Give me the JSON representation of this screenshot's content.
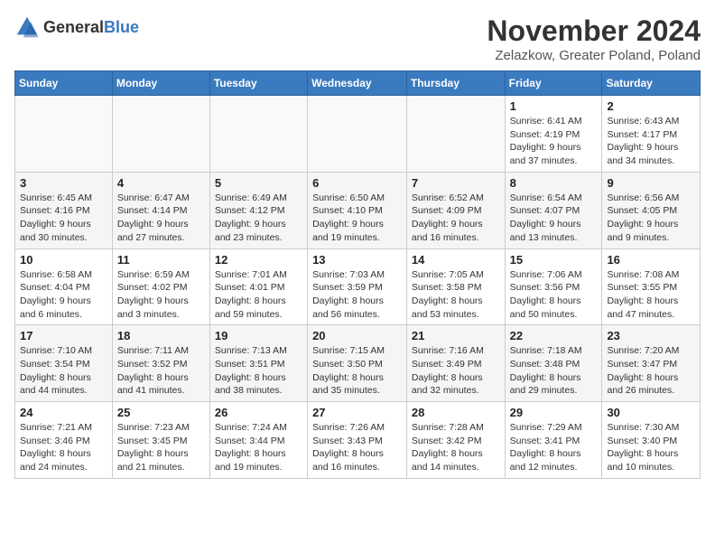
{
  "logo": {
    "text_general": "General",
    "text_blue": "Blue"
  },
  "title": "November 2024",
  "location": "Zelazkow, Greater Poland, Poland",
  "headers": [
    "Sunday",
    "Monday",
    "Tuesday",
    "Wednesday",
    "Thursday",
    "Friday",
    "Saturday"
  ],
  "weeks": [
    [
      {
        "day": "",
        "info": "",
        "empty": true
      },
      {
        "day": "",
        "info": "",
        "empty": true
      },
      {
        "day": "",
        "info": "",
        "empty": true
      },
      {
        "day": "",
        "info": "",
        "empty": true
      },
      {
        "day": "",
        "info": "",
        "empty": true
      },
      {
        "day": "1",
        "info": "Sunrise: 6:41 AM\nSunset: 4:19 PM\nDaylight: 9 hours and 37 minutes."
      },
      {
        "day": "2",
        "info": "Sunrise: 6:43 AM\nSunset: 4:17 PM\nDaylight: 9 hours and 34 minutes."
      }
    ],
    [
      {
        "day": "3",
        "info": "Sunrise: 6:45 AM\nSunset: 4:16 PM\nDaylight: 9 hours and 30 minutes."
      },
      {
        "day": "4",
        "info": "Sunrise: 6:47 AM\nSunset: 4:14 PM\nDaylight: 9 hours and 27 minutes."
      },
      {
        "day": "5",
        "info": "Sunrise: 6:49 AM\nSunset: 4:12 PM\nDaylight: 9 hours and 23 minutes."
      },
      {
        "day": "6",
        "info": "Sunrise: 6:50 AM\nSunset: 4:10 PM\nDaylight: 9 hours and 19 minutes."
      },
      {
        "day": "7",
        "info": "Sunrise: 6:52 AM\nSunset: 4:09 PM\nDaylight: 9 hours and 16 minutes."
      },
      {
        "day": "8",
        "info": "Sunrise: 6:54 AM\nSunset: 4:07 PM\nDaylight: 9 hours and 13 minutes."
      },
      {
        "day": "9",
        "info": "Sunrise: 6:56 AM\nSunset: 4:05 PM\nDaylight: 9 hours and 9 minutes."
      }
    ],
    [
      {
        "day": "10",
        "info": "Sunrise: 6:58 AM\nSunset: 4:04 PM\nDaylight: 9 hours and 6 minutes."
      },
      {
        "day": "11",
        "info": "Sunrise: 6:59 AM\nSunset: 4:02 PM\nDaylight: 9 hours and 3 minutes."
      },
      {
        "day": "12",
        "info": "Sunrise: 7:01 AM\nSunset: 4:01 PM\nDaylight: 8 hours and 59 minutes."
      },
      {
        "day": "13",
        "info": "Sunrise: 7:03 AM\nSunset: 3:59 PM\nDaylight: 8 hours and 56 minutes."
      },
      {
        "day": "14",
        "info": "Sunrise: 7:05 AM\nSunset: 3:58 PM\nDaylight: 8 hours and 53 minutes."
      },
      {
        "day": "15",
        "info": "Sunrise: 7:06 AM\nSunset: 3:56 PM\nDaylight: 8 hours and 50 minutes."
      },
      {
        "day": "16",
        "info": "Sunrise: 7:08 AM\nSunset: 3:55 PM\nDaylight: 8 hours and 47 minutes."
      }
    ],
    [
      {
        "day": "17",
        "info": "Sunrise: 7:10 AM\nSunset: 3:54 PM\nDaylight: 8 hours and 44 minutes."
      },
      {
        "day": "18",
        "info": "Sunrise: 7:11 AM\nSunset: 3:52 PM\nDaylight: 8 hours and 41 minutes."
      },
      {
        "day": "19",
        "info": "Sunrise: 7:13 AM\nSunset: 3:51 PM\nDaylight: 8 hours and 38 minutes."
      },
      {
        "day": "20",
        "info": "Sunrise: 7:15 AM\nSunset: 3:50 PM\nDaylight: 8 hours and 35 minutes."
      },
      {
        "day": "21",
        "info": "Sunrise: 7:16 AM\nSunset: 3:49 PM\nDaylight: 8 hours and 32 minutes."
      },
      {
        "day": "22",
        "info": "Sunrise: 7:18 AM\nSunset: 3:48 PM\nDaylight: 8 hours and 29 minutes."
      },
      {
        "day": "23",
        "info": "Sunrise: 7:20 AM\nSunset: 3:47 PM\nDaylight: 8 hours and 26 minutes."
      }
    ],
    [
      {
        "day": "24",
        "info": "Sunrise: 7:21 AM\nSunset: 3:46 PM\nDaylight: 8 hours and 24 minutes."
      },
      {
        "day": "25",
        "info": "Sunrise: 7:23 AM\nSunset: 3:45 PM\nDaylight: 8 hours and 21 minutes."
      },
      {
        "day": "26",
        "info": "Sunrise: 7:24 AM\nSunset: 3:44 PM\nDaylight: 8 hours and 19 minutes."
      },
      {
        "day": "27",
        "info": "Sunrise: 7:26 AM\nSunset: 3:43 PM\nDaylight: 8 hours and 16 minutes."
      },
      {
        "day": "28",
        "info": "Sunrise: 7:28 AM\nSunset: 3:42 PM\nDaylight: 8 hours and 14 minutes."
      },
      {
        "day": "29",
        "info": "Sunrise: 7:29 AM\nSunset: 3:41 PM\nDaylight: 8 hours and 12 minutes."
      },
      {
        "day": "30",
        "info": "Sunrise: 7:30 AM\nSunset: 3:40 PM\nDaylight: 8 hours and 10 minutes."
      }
    ]
  ]
}
